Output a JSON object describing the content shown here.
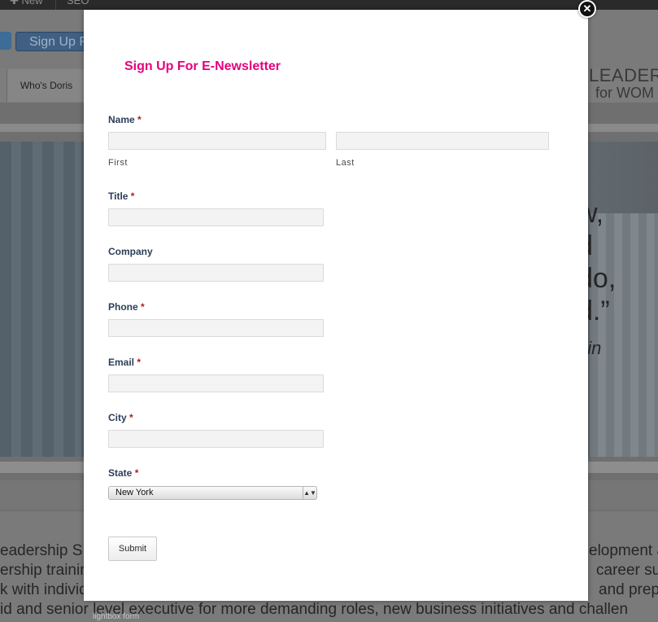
{
  "admin_bar": {
    "new_label": "New",
    "seo_label": "SEO"
  },
  "header": {
    "signup_button": "Sign Up F",
    "nav_tab": "Who's Doris",
    "logo_line1": "LEADER",
    "logo_line2": "for WOM"
  },
  "hero": {
    "quote_lines": [
      "w,",
      "d",
      "do,",
      "d.”"
    ],
    "quote_author": "ain"
  },
  "body_text": {
    "lines": [
      {
        "left": "eadership S",
        "right": "elopment a"
      },
      {
        "left": "ership trainin",
        "right": "career suc"
      },
      {
        "left": "k with individ",
        "right": "and prepa"
      },
      {
        "left": "id and senior level executive for more demanding roles, new business initiatives and challen",
        "right": ""
      }
    ],
    "caption": "lightbox form"
  },
  "modal": {
    "title": "Sign Up For E-Newsletter",
    "fields": {
      "name": {
        "label": "Name",
        "required": "*",
        "first_sublabel": "First",
        "last_sublabel": "Last",
        "first_value": "",
        "last_value": ""
      },
      "title": {
        "label": "Title",
        "required": "*",
        "value": ""
      },
      "company": {
        "label": "Company",
        "value": ""
      },
      "phone": {
        "label": "Phone",
        "required": "*",
        "value": ""
      },
      "email": {
        "label": "Email",
        "required": "*",
        "value": ""
      },
      "city": {
        "label": "City",
        "required": "*",
        "value": ""
      },
      "state": {
        "label": "State",
        "required": "*",
        "selected": "New York"
      }
    },
    "submit_label": "Submit"
  },
  "icons": {
    "close": "close-icon",
    "social": "twitter-icon",
    "plus": "plus-icon",
    "select_arrows": "select-arrows-icon"
  }
}
